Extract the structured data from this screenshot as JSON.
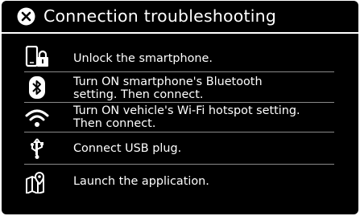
{
  "header": {
    "title": "Connection troubleshooting",
    "close_icon": "close-circle-icon"
  },
  "items": [
    {
      "icon": "smartphone-lock-icon",
      "text": "Unlock the smartphone."
    },
    {
      "icon": "bluetooth-icon",
      "line1": "Turn ON smartphone's Bluetooth",
      "line2": "setting. Then connect."
    },
    {
      "icon": "wifi-icon",
      "line1": "Turn ON vehicle's Wi-Fi hotspot setting.",
      "line2": "Then connect."
    },
    {
      "icon": "usb-icon",
      "text": "Connect USB plug."
    },
    {
      "icon": "map-pin-icon",
      "text": "Launch the application."
    }
  ],
  "colors": {
    "background": "#000000",
    "text": "#ffffff",
    "divider": "#8a8a8a"
  }
}
